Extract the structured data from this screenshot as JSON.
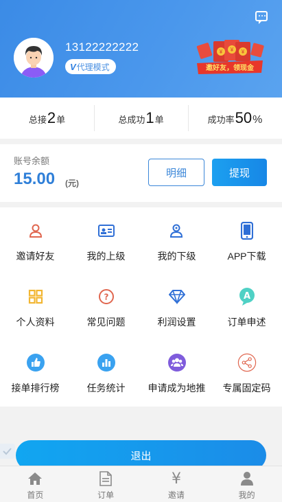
{
  "header": {
    "phone": "13122222222",
    "mode_badge": "代理模式",
    "promo_text": "邀好友，领现金"
  },
  "stats": [
    {
      "prefix": "总接",
      "value": "2",
      "suffix": "单"
    },
    {
      "prefix": "总成功",
      "value": "1",
      "suffix": "单"
    },
    {
      "prefix": "成功率",
      "value": "50",
      "suffix": "%"
    }
  ],
  "balance": {
    "label": "账号余额",
    "amount": "15.00",
    "unit": "(元)",
    "detail_button": "明细",
    "withdraw_button": "提现"
  },
  "menu": [
    {
      "label": "邀请好友",
      "icon": "user-icon"
    },
    {
      "label": "我的上级",
      "icon": "id-card-icon"
    },
    {
      "label": "我的下级",
      "icon": "users-icon"
    },
    {
      "label": "APP下载",
      "icon": "phone-icon"
    },
    {
      "label": "个人资料",
      "icon": "grid-icon"
    },
    {
      "label": "常见问题",
      "icon": "question-icon"
    },
    {
      "label": "利润设置",
      "icon": "diamond-icon"
    },
    {
      "label": "订单申述",
      "icon": "a-badge-icon"
    },
    {
      "label": "接单排行榜",
      "icon": "thumbs-up-icon"
    },
    {
      "label": "任务统计",
      "icon": "bar-chart-icon"
    },
    {
      "label": "申请成为地推",
      "icon": "group-icon"
    },
    {
      "label": "专属固定码",
      "icon": "share-icon"
    }
  ],
  "logout_label": "退出",
  "tabs": [
    {
      "label": "首页",
      "icon": "home-icon"
    },
    {
      "label": "订单",
      "icon": "document-icon"
    },
    {
      "label": "邀请",
      "icon": "yen-icon"
    },
    {
      "label": "我的",
      "icon": "person-icon"
    }
  ],
  "colors": {
    "header_blue": "#4a97ec",
    "accent_blue": "#2f7fd8",
    "button_blue": "#1787e6"
  }
}
